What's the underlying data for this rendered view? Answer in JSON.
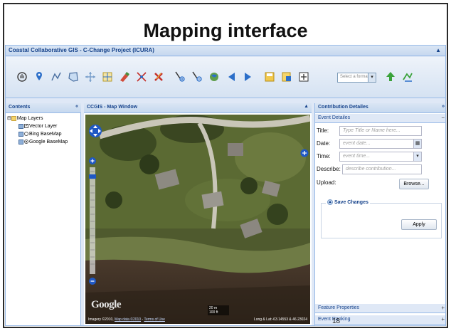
{
  "slide": {
    "title": "Mapping interface",
    "page_number": "18"
  },
  "app": {
    "title": "Coastal Collaborative GIS - C-Change Project (ICURA)",
    "toolbar": {
      "format_select_placeholder": "Select a format"
    }
  },
  "contents_panel": {
    "title": "Contents",
    "tree": {
      "root": "Map Layers",
      "items": [
        {
          "label": "Vector Layer",
          "control": "checkbox",
          "checked": true
        },
        {
          "label": "Bing BaseMap",
          "control": "radio",
          "checked": false
        },
        {
          "label": "Google BaseMap",
          "control": "radio",
          "checked": true
        }
      ]
    }
  },
  "map_panel": {
    "title": "CCGIS - Map Window",
    "logo": "Google",
    "attribution_imagery": "Imagery ©2010",
    "attribution_mapdata": "Map data ©2010",
    "terms_link": "Terms of Use",
    "coords_readout": "Long & Lat:-63.14553 & 46.23024",
    "scale_top": "20 m",
    "scale_bottom": "100 ft"
  },
  "contribution_panel": {
    "title": "Contribution Detailes",
    "section_event": "Event Detailes",
    "fields": {
      "title_label": "Title:",
      "title_placeholder": "Type Title or Name here...",
      "date_label": "Date:",
      "date_placeholder": "event date...",
      "time_label": "Time:",
      "time_placeholder": "event time...",
      "describe_label": "Describe:",
      "describe_placeholder": "describe contribution...",
      "upload_label": "Upload:"
    },
    "browse_button": "Browse...",
    "save_changes_label": "Save Changes",
    "apply_button": "Apply",
    "section_feature_properties": "Feature Properties",
    "section_event_ranking": "Event Ranking"
  },
  "colors": {
    "header_text": "#15428b",
    "panel_border": "#99bbe8",
    "panel_bg": "#dfe8f6"
  },
  "icons": [
    "pan-hand-icon",
    "marker-icon",
    "line-icon",
    "polygon-icon",
    "move-icon",
    "measure-icon",
    "edit-feature-icon",
    "select-feature-icon",
    "delete-feature-icon",
    "zoom-in-icon",
    "zoom-out-icon",
    "zoom-extent-icon",
    "back-icon",
    "forward-icon",
    "save-icon",
    "print-icon",
    "full-screen-icon",
    "upload-icon",
    "export-icon"
  ]
}
